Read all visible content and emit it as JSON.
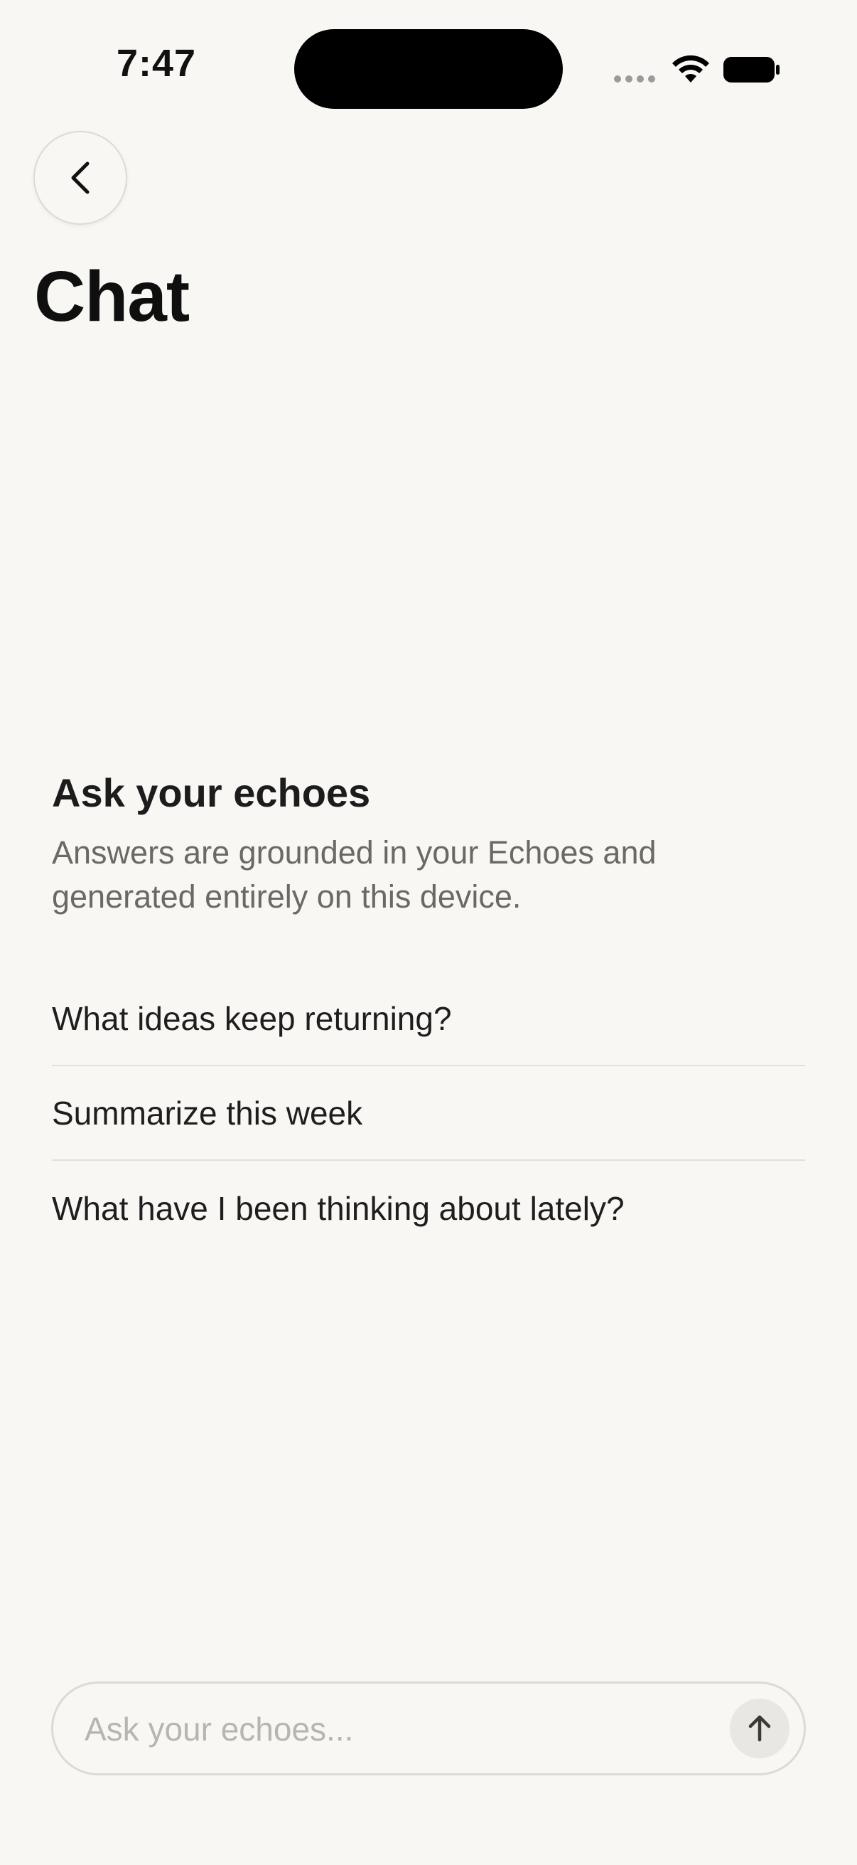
{
  "status_bar": {
    "time": "7:47"
  },
  "header": {
    "title": "Chat",
    "back_icon": "chevron-left-icon"
  },
  "empty_state": {
    "heading": "Ask your echoes",
    "subtitle": "Answers are grounded in your Echoes and generated entirely on this device."
  },
  "suggestions": [
    "What ideas keep returning?",
    "Summarize this week",
    "What have I been thinking about lately?"
  ],
  "composer": {
    "placeholder": "Ask your echoes...",
    "value": "",
    "send_icon": "arrow-up-icon"
  },
  "colors": {
    "background": "#F8F7F4",
    "text_primary": "#1E1E1E",
    "text_secondary": "#6B6966",
    "divider": "#E2E0DC",
    "send_button_bg": "#E9E7E3"
  }
}
